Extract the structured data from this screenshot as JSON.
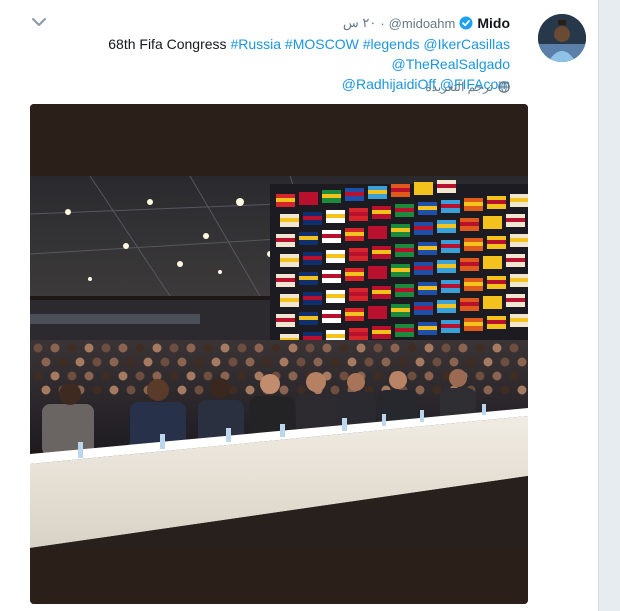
{
  "tweet": {
    "author_name": "Mido",
    "author_handle": "@midoahm",
    "timestamp": "٢٠ س",
    "text_plain": "68th Fifa Congress",
    "links": [
      "#Russia",
      "#MOSCOW",
      "#legends",
      "@IkerCasillas",
      "@TheRealSalgado",
      "@RadhijaidiOff",
      "@FIFAcom"
    ],
    "translate_label": "ترجم التغريدة"
  },
  "icons": {
    "menu": "chevron-down-icon",
    "verified": "verified-badge-icon",
    "translate": "globe-icon"
  },
  "colors": {
    "link": "#1b95e0",
    "verified": "#1da1f2",
    "muted": "#657786",
    "text": "#14171a"
  }
}
